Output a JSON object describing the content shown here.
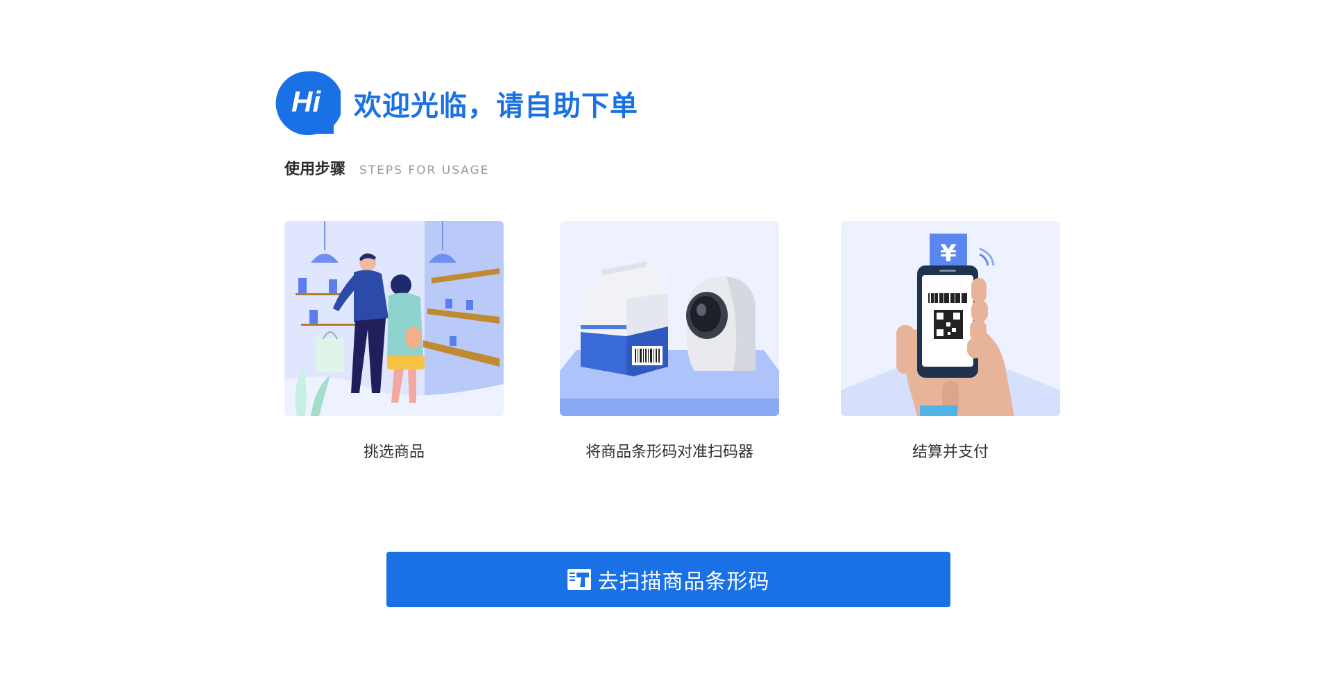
{
  "header": {
    "badge_text": "Hi",
    "welcome": "欢迎光临，请自助下单"
  },
  "steps": {
    "title_cn": "使用步骤",
    "title_en": "STEPS FOR USAGE",
    "items": [
      {
        "label": "挑选商品",
        "icon": "shopping-couple-illustration"
      },
      {
        "label": "将商品条形码对准扫码器",
        "icon": "barcode-scanner-illustration"
      },
      {
        "label": "结算并支付",
        "icon": "mobile-payment-illustration"
      }
    ]
  },
  "action": {
    "scan_label": "去扫描商品条形码",
    "icon": "scanner-gun-icon"
  },
  "colors": {
    "accent": "#1a70e5",
    "card_bg": "#eef2ff",
    "text_dark": "#333333",
    "text_muted": "#9a9a9a"
  }
}
